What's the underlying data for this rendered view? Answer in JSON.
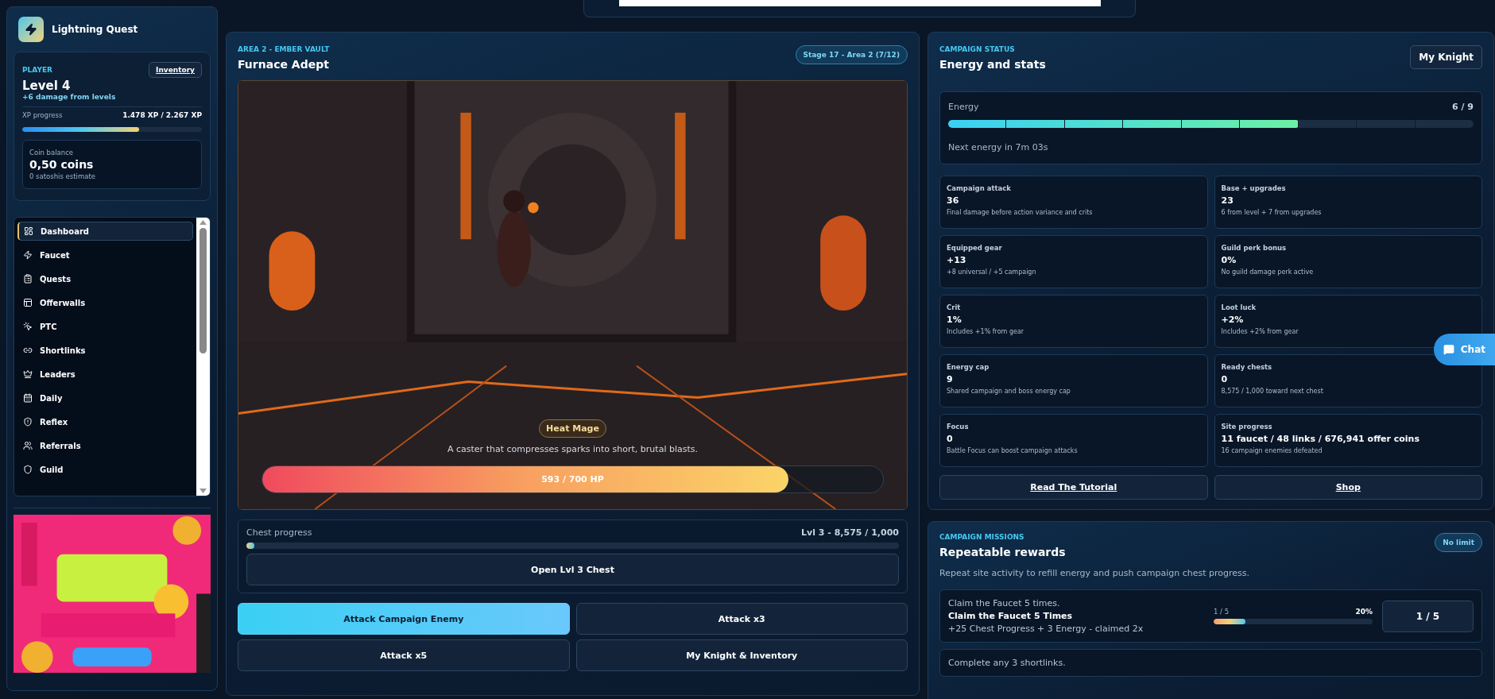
{
  "brand": {
    "title": "Lightning Quest"
  },
  "player": {
    "eyebrow": "PLAYER",
    "level": "Level 4",
    "bonus": "+6 damage from levels",
    "inventory": "Inventory",
    "xp_label": "XP progress",
    "xp_value": "1.478 XP / 2.267 XP",
    "xp_bar": {
      "level": 0.65
    },
    "coin_label": "Coin balance",
    "coins": "0,50 coins",
    "coin_note": "0 satoshis estimate"
  },
  "nav": [
    {
      "label": "Dashboard",
      "selected": true
    },
    {
      "label": "Faucet",
      "selected": false
    },
    {
      "label": "Quests",
      "selected": false
    },
    {
      "label": "Offerwalls",
      "selected": false
    },
    {
      "label": "PTC",
      "selected": false
    },
    {
      "label": "Shortlinks",
      "selected": false
    },
    {
      "label": "Leaders",
      "selected": false
    },
    {
      "label": "Daily",
      "selected": false
    },
    {
      "label": "Reflex",
      "selected": false
    },
    {
      "label": "Referrals",
      "selected": false
    },
    {
      "label": "Guild",
      "selected": false
    }
  ],
  "battle": {
    "eyebrow": "AREA 2 - EMBER VAULT",
    "title": "Furnace Adept",
    "stage": "Stage 17 - Area 2 (7/12)",
    "enemy": "Heat Mage",
    "enemy_text": "A caster that compresses sparks into short, brutal blasts.",
    "hp": "593 / 700 HP",
    "hp_bar": {
      "level": 0.847
    },
    "chest_label": "Chest progress",
    "chest_value": "Lvl 3 - 8,575 / 1,000",
    "chest_bar": {
      "level": 0.012
    },
    "chest_button": "Open Lvl 3 Chest",
    "actions": [
      {
        "label": "Attack Campaign Enemy",
        "primary": true
      },
      {
        "label": "Attack x3",
        "primary": false
      },
      {
        "label": "Attack x5",
        "primary": false
      },
      {
        "label": "My Knight & Inventory",
        "primary": false
      }
    ]
  },
  "status": {
    "eyebrow": "CAMPAIGN STATUS",
    "title": "Energy and stats",
    "knight": "My Knight",
    "energy_label": "Energy",
    "energy_value": "6 / 9",
    "energy_bar": {
      "level": 0.667
    },
    "next_energy": "Next energy in 7m 03s",
    "stats": [
      {
        "label": "Campaign attack",
        "value": "36",
        "note": "Final damage before action variance and crits"
      },
      {
        "label": "Base + upgrades",
        "value": "23",
        "note": "6 from level + 7 from upgrades"
      },
      {
        "label": "Equipped gear",
        "value": "+13",
        "note": "+8 universal / +5 campaign"
      },
      {
        "label": "Guild perk bonus",
        "value": "0%",
        "note": "No guild damage perk active"
      },
      {
        "label": "Crit",
        "value": "1%",
        "note": "Includes +1% from gear"
      },
      {
        "label": "Loot luck",
        "value": "+2%",
        "note": "Includes +2% from gear"
      },
      {
        "label": "Energy cap",
        "value": "9",
        "note": "Shared campaign and boss energy cap"
      },
      {
        "label": "Ready chests",
        "value": "0",
        "note": "8,575 / 1,000 toward next chest"
      },
      {
        "label": "Focus",
        "value": "0",
        "note": "Battle Focus can boost campaign attacks"
      },
      {
        "label": "Site progress",
        "value": "11 faucet / 48 links / 676,941 offer coins",
        "note": "16 campaign enemies defeated"
      }
    ],
    "links": [
      "Read The Tutorial",
      "Shop"
    ]
  },
  "missions": {
    "eyebrow": "CAMPAIGN MISSIONS",
    "title": "Repeatable rewards",
    "badge": "No limit",
    "text": "Repeat site activity to refill energy and push campaign chest progress.",
    "items": [
      {
        "task": "Claim the Faucet 5 times.",
        "title": "Claim the Faucet 5 Times",
        "reward": "+25 Chest Progress + 3 Energy - claimed 2x",
        "count": "1 / 5",
        "percent": "20%",
        "level": 0.2,
        "button": "1 / 5"
      },
      {
        "task": "Complete any 3 shortlinks."
      }
    ]
  },
  "chat": {
    "label": "Chat"
  }
}
